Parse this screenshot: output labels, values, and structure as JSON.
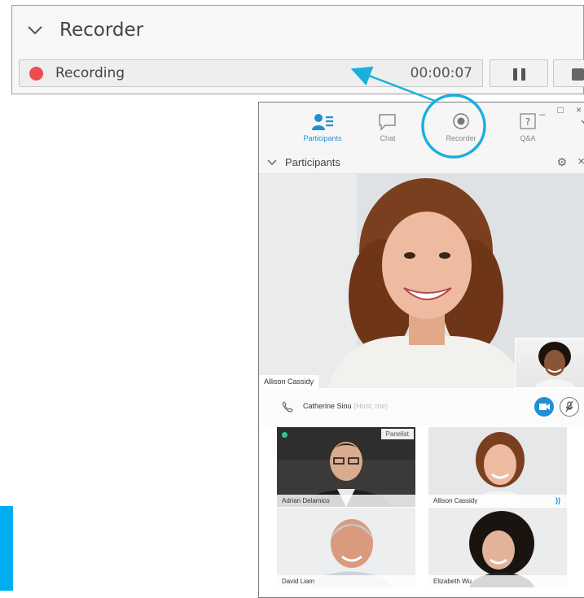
{
  "recorder_panel": {
    "title": "Recorder",
    "status_label": "Recording",
    "elapsed_time": "00:00:07",
    "status_color": "#ee4d4f"
  },
  "window": {
    "toolbar": [
      {
        "label": "Participants",
        "icon": "participants-icon",
        "active": true
      },
      {
        "label": "Chat",
        "icon": "chat-icon",
        "active": false
      },
      {
        "label": "Recorder",
        "icon": "recorder-icon",
        "active": false
      },
      {
        "label": "Q&A",
        "icon": "qa-icon",
        "active": false
      }
    ],
    "participants_panel": {
      "title": "Participants",
      "main_video_name": "Allison Cassidy",
      "host": {
        "name": "Catherine Sinu",
        "role": "(Host, me)"
      },
      "tiles": [
        {
          "name": "Adrian Delamico",
          "badge": "Panelist"
        },
        {
          "name": "Allison Cassidy",
          "badge": ""
        },
        {
          "name": "David Liam",
          "badge": ""
        },
        {
          "name": "Elizabeth Wu",
          "badge": ""
        }
      ]
    }
  },
  "colors": {
    "accent": "#1f8fd8",
    "highlight": "#1ab0dd",
    "side_accent": "#00aeef"
  }
}
